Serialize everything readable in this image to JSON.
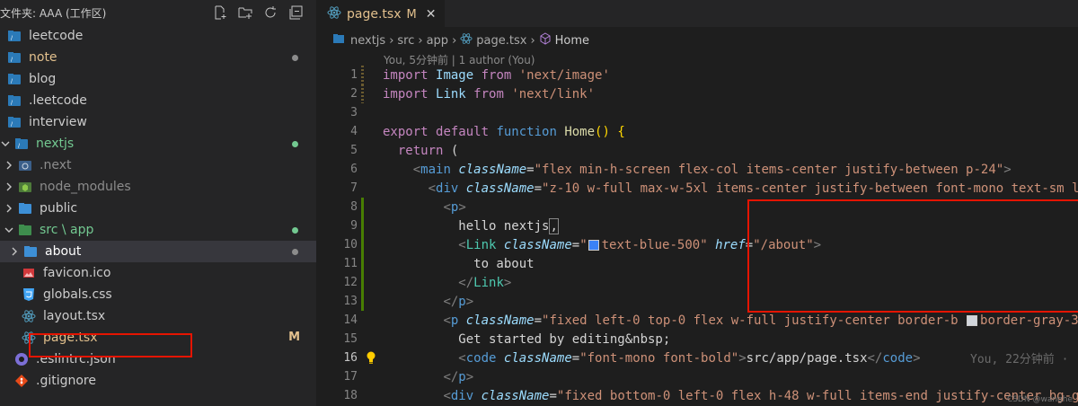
{
  "explorer": {
    "title": "文件夹: AAA (工作区)",
    "actions": [
      "new-file-icon",
      "new-folder-icon",
      "refresh-icon",
      "collapse-icon"
    ],
    "items": [
      {
        "label": "leetcode",
        "indent": 8,
        "icon": "folder-root",
        "chev": "none",
        "color": "#cccccc",
        "marker": "none"
      },
      {
        "label": "note",
        "indent": 8,
        "icon": "folder-root",
        "chev": "none",
        "color": "#e2c08d",
        "marker": "dot-grey"
      },
      {
        "label": "blog",
        "indent": 8,
        "icon": "folder-root",
        "chev": "none",
        "color": "#cccccc",
        "marker": "none"
      },
      {
        "label": ".leetcode",
        "indent": 8,
        "icon": "folder-root",
        "chev": "none",
        "color": "#cccccc",
        "marker": "none"
      },
      {
        "label": "interview",
        "indent": 8,
        "icon": "folder-root",
        "chev": "none",
        "color": "#cccccc",
        "marker": "none"
      },
      {
        "label": "nextjs",
        "indent": 0,
        "icon": "folder-root",
        "chev": "down",
        "color": "#73c991",
        "marker": "dot-green"
      },
      {
        "label": ".next",
        "indent": 4,
        "icon": "next-folder",
        "chev": "right",
        "color": "#8c8c8c",
        "marker": "none"
      },
      {
        "label": "node_modules",
        "indent": 4,
        "icon": "node-folder",
        "chev": "right",
        "color": "#8c8c8c",
        "marker": "none"
      },
      {
        "label": "public",
        "indent": 4,
        "icon": "folder",
        "chev": "right",
        "color": "#cccccc",
        "marker": "none"
      },
      {
        "label": "src \\ app",
        "indent": 4,
        "icon": "src-folder",
        "chev": "down",
        "color": "#73c991",
        "marker": "dot-green"
      },
      {
        "label": "about",
        "indent": 10,
        "icon": "folder-blue",
        "chev": "right",
        "color": "#ffffff",
        "marker": "dot-grey",
        "selected": true
      },
      {
        "label": "favicon.ico",
        "indent": 24,
        "icon": "ico-file",
        "chev": "none",
        "color": "#cccccc",
        "marker": "none"
      },
      {
        "label": "globals.css",
        "indent": 24,
        "icon": "css-file",
        "chev": "none",
        "color": "#cccccc",
        "marker": "none"
      },
      {
        "label": "layout.tsx",
        "indent": 24,
        "icon": "react-file",
        "chev": "none",
        "color": "#cccccc",
        "marker": "none"
      },
      {
        "label": "page.tsx",
        "indent": 24,
        "icon": "react-file",
        "chev": "none",
        "color": "#e2c08d",
        "marker": "M"
      },
      {
        "label": ".eslintrc.json",
        "indent": 16,
        "icon": "eslint-file",
        "chev": "none",
        "color": "#cccccc",
        "marker": "none"
      },
      {
        "label": ".gitignore",
        "indent": 16,
        "icon": "git-file",
        "chev": "none",
        "color": "#cccccc",
        "marker": "none"
      }
    ]
  },
  "tab": {
    "name": "page.tsx",
    "modified": "M",
    "close": "✕"
  },
  "breadcrumb": [
    "nextjs",
    "src",
    "app",
    "page.tsx",
    "Home"
  ],
  "blame_header": "You, 5分钟前 | 1 author (You)",
  "inline_blame": "You, 22分钟前 ·",
  "watermark": "CSDN @wanghe",
  "code_lines": [
    {
      "n": "1",
      "g": "changed",
      "t": [
        [
          "kw2",
          "import "
        ],
        [
          "var",
          "Image "
        ],
        [
          "kw2",
          "from "
        ],
        [
          "str",
          "'next/image'"
        ]
      ]
    },
    {
      "n": "2",
      "g": "changed",
      "t": [
        [
          "kw2",
          "import "
        ],
        [
          "var",
          "Link "
        ],
        [
          "kw2",
          "from "
        ],
        [
          "str",
          "'next/link'"
        ]
      ]
    },
    {
      "n": "3",
      "g": "none",
      "t": []
    },
    {
      "n": "4",
      "g": "none",
      "t": [
        [
          "kw2",
          "export "
        ],
        [
          "kw2",
          "default "
        ],
        [
          "kw",
          "function "
        ],
        [
          "fn",
          "Home"
        ],
        [
          "brk",
          "() {"
        ]
      ]
    },
    {
      "n": "5",
      "g": "none",
      "t": [
        [
          "pl",
          "  "
        ],
        [
          "kw2",
          "return "
        ],
        [
          "pl",
          "("
        ]
      ]
    },
    {
      "n": "6",
      "g": "none",
      "t": [
        [
          "pl",
          "    "
        ],
        [
          "punct",
          "<"
        ],
        [
          "tag",
          "main "
        ],
        [
          "attr",
          "className"
        ],
        [
          "pl",
          "="
        ],
        [
          "str",
          "\"flex min-h-screen flex-col items-center justify-between p-24\""
        ],
        [
          "punct",
          ">"
        ]
      ]
    },
    {
      "n": "7",
      "g": "none",
      "t": [
        [
          "pl",
          "      "
        ],
        [
          "punct",
          "<"
        ],
        [
          "tag",
          "div "
        ],
        [
          "attr",
          "className"
        ],
        [
          "pl",
          "="
        ],
        [
          "str",
          "\"z-10 w-full max-w-5xl items-center justify-between font-mono text-sm l"
        ]
      ]
    },
    {
      "n": "8",
      "g": "added",
      "t": [
        [
          "pl",
          "        "
        ],
        [
          "punct",
          "<"
        ],
        [
          "tag",
          "p"
        ],
        [
          "punct",
          ">"
        ]
      ]
    },
    {
      "n": "9",
      "g": "added",
      "t": [
        [
          "pl",
          "          hello nextjs"
        ],
        [
          "wbox",
          ","
        ]
      ]
    },
    {
      "n": "10",
      "g": "added",
      "t": [
        [
          "pl",
          "          "
        ],
        [
          "punct",
          "<"
        ],
        [
          "comp",
          "Link "
        ],
        [
          "attr",
          "className"
        ],
        [
          "pl",
          "="
        ],
        [
          "str",
          "\""
        ],
        [
          "swatch-blue",
          ""
        ],
        [
          "str",
          "text-blue-500\" "
        ],
        [
          "attr",
          "href"
        ],
        [
          "pl",
          "="
        ],
        [
          "str",
          "\"/about\""
        ],
        [
          "punct",
          ">"
        ]
      ]
    },
    {
      "n": "11",
      "g": "added",
      "t": [
        [
          "pl",
          "            to about"
        ]
      ]
    },
    {
      "n": "12",
      "g": "added",
      "t": [
        [
          "pl",
          "          "
        ],
        [
          "punct",
          "</"
        ],
        [
          "comp",
          "Link"
        ],
        [
          "punct",
          ">"
        ]
      ]
    },
    {
      "n": "13",
      "g": "added",
      "t": [
        [
          "pl",
          "        "
        ],
        [
          "punct",
          "</"
        ],
        [
          "tag",
          "p"
        ],
        [
          "punct",
          ">"
        ]
      ]
    },
    {
      "n": "14",
      "g": "none",
      "t": [
        [
          "pl",
          "        "
        ],
        [
          "punct",
          "<"
        ],
        [
          "tag",
          "p "
        ],
        [
          "attr",
          "className"
        ],
        [
          "pl",
          "="
        ],
        [
          "str",
          "\"fixed left-0 top-0 flex w-full justify-center border-b "
        ],
        [
          "swatch-grey",
          ""
        ],
        [
          "str",
          "border-gray-3"
        ]
      ]
    },
    {
      "n": "15",
      "g": "none",
      "t": [
        [
          "pl",
          "          Get started by editing&nbsp;"
        ]
      ]
    },
    {
      "n": "16",
      "g": "none",
      "active": true,
      "t": [
        [
          "pl",
          "          "
        ],
        [
          "punct",
          "<"
        ],
        [
          "tag",
          "code "
        ],
        [
          "attr",
          "className"
        ],
        [
          "pl",
          "="
        ],
        [
          "str",
          "\"font-mono font-bold\""
        ],
        [
          "punct",
          ">"
        ],
        [
          "pl",
          "src/app/page.tsx"
        ],
        [
          "punct",
          "</"
        ],
        [
          "tag",
          "code"
        ],
        [
          "punct",
          ">"
        ]
      ]
    },
    {
      "n": "17",
      "g": "none",
      "t": [
        [
          "pl",
          "        "
        ],
        [
          "punct",
          "</"
        ],
        [
          "tag",
          "p"
        ],
        [
          "punct",
          ">"
        ]
      ]
    },
    {
      "n": "18",
      "g": "none",
      "t": [
        [
          "pl",
          "        "
        ],
        [
          "punct",
          "<"
        ],
        [
          "tag",
          "div "
        ],
        [
          "attr",
          "className"
        ],
        [
          "pl",
          "="
        ],
        [
          "str",
          "\"fixed bottom-0 left-0 flex h-48 w-full items-end justify-center bg-g"
        ]
      ]
    }
  ]
}
